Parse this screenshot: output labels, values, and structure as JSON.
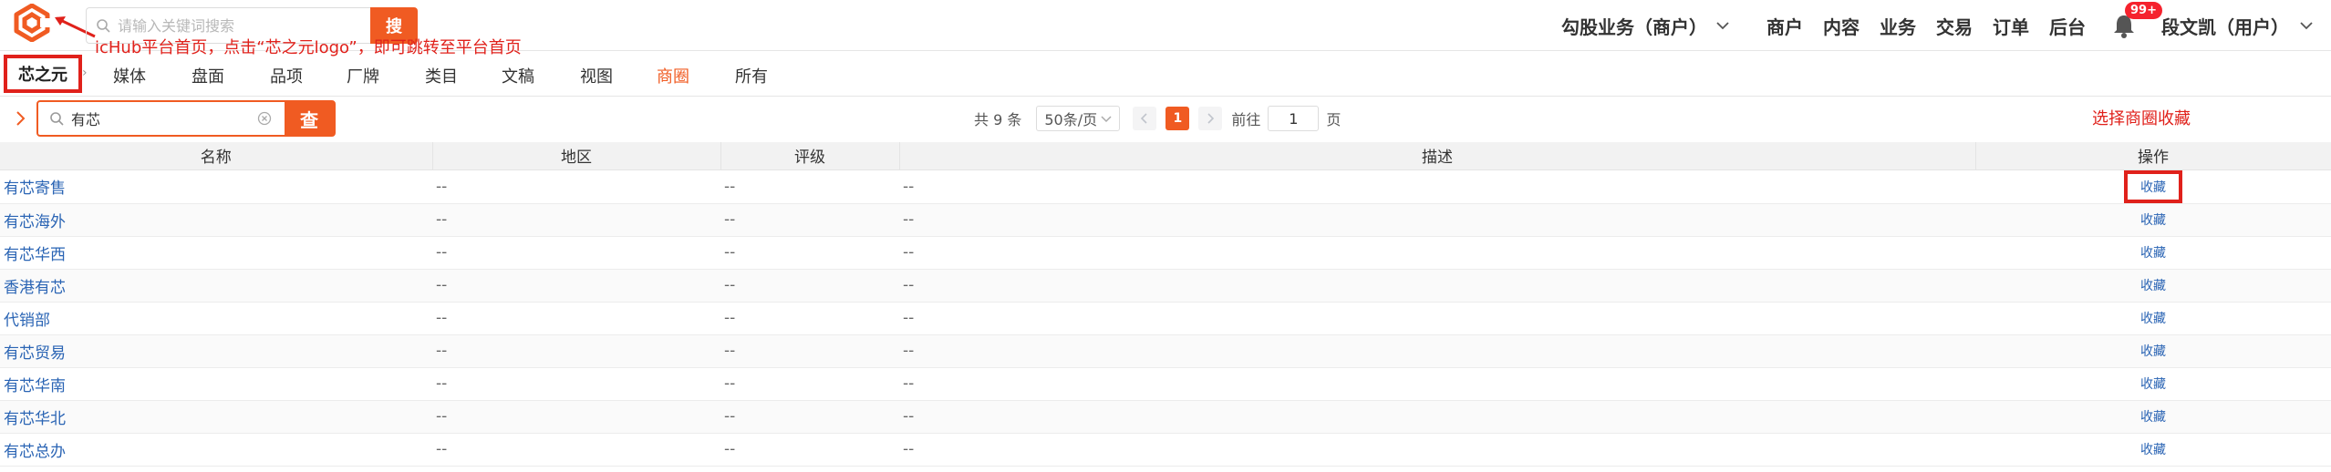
{
  "header": {
    "search_placeholder": "请输入关键词搜索",
    "search_button": "搜",
    "annotation_logo": "icHub平台首页，点击“芯之元logo”，即可跳转至平台首页",
    "business_switcher": "勾股业务（商户）",
    "nav": [
      "商户",
      "内容",
      "业务",
      "交易",
      "订单",
      "后台"
    ],
    "notification_badge": "99+",
    "user_menu": "段文凯（用户）"
  },
  "subnav": {
    "brand": "芯之元",
    "tabs": [
      "媒体",
      "盘面",
      "品项",
      "厂牌",
      "类目",
      "文稿",
      "视图",
      "商圈",
      "所有"
    ],
    "active_tab": "商圈"
  },
  "toolbar": {
    "query_value": "有芯",
    "query_button": "查",
    "total_text": "共 9 条",
    "page_size": "50条/页",
    "current_page": "1",
    "goto_label": "前往",
    "goto_value": "1",
    "page_suffix": "页",
    "annotation_fav": "选择商圈收藏"
  },
  "table": {
    "columns": [
      "名称",
      "地区",
      "评级",
      "描述",
      "操作"
    ],
    "rows": [
      {
        "name": "有芯寄售",
        "region": "--",
        "rating": "--",
        "desc": "--",
        "action": "收藏"
      },
      {
        "name": "有芯海外",
        "region": "--",
        "rating": "--",
        "desc": "--",
        "action": "收藏"
      },
      {
        "name": "有芯华西",
        "region": "--",
        "rating": "--",
        "desc": "--",
        "action": "收藏"
      },
      {
        "name": "香港有芯",
        "region": "--",
        "rating": "--",
        "desc": "--",
        "action": "收藏"
      },
      {
        "name": "代销部",
        "region": "--",
        "rating": "--",
        "desc": "--",
        "action": "收藏"
      },
      {
        "name": "有芯贸易",
        "region": "--",
        "rating": "--",
        "desc": "--",
        "action": "收藏"
      },
      {
        "name": "有芯华南",
        "region": "--",
        "rating": "--",
        "desc": "--",
        "action": "收藏"
      },
      {
        "name": "有芯华北",
        "region": "--",
        "rating": "--",
        "desc": "--",
        "action": "收藏"
      },
      {
        "name": "有芯总办",
        "region": "--",
        "rating": "--",
        "desc": "--",
        "action": "收藏"
      }
    ]
  },
  "colors": {
    "accent": "#f05b22",
    "annotation": "#e0211b",
    "link": "#2a64b4"
  },
  "icons": [
    "ichub-logo-icon",
    "search-icon",
    "chevron-down-icon",
    "bell-icon",
    "chevron-right-icon",
    "clear-icon",
    "chevron-left-icon",
    "arrow-icon"
  ]
}
